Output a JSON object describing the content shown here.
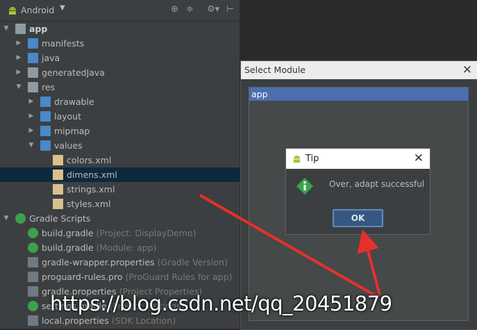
{
  "project_view": {
    "title": "Android",
    "tree": [
      {
        "label": "app",
        "hint": "",
        "depth": 0,
        "arrow": "down",
        "icon": "module-folder-icon",
        "bold": true
      },
      {
        "label": "manifests",
        "hint": "",
        "depth": 1,
        "arrow": "right",
        "icon": "folder-icon"
      },
      {
        "label": "java",
        "hint": "",
        "depth": 1,
        "arrow": "right",
        "icon": "folder-icon"
      },
      {
        "label": "generatedJava",
        "hint": "",
        "depth": 1,
        "arrow": "right",
        "icon": "generated-folder-icon"
      },
      {
        "label": "res",
        "hint": "",
        "depth": 1,
        "arrow": "down",
        "icon": "res-folder-icon"
      },
      {
        "label": "drawable",
        "hint": "",
        "depth": 2,
        "arrow": "right",
        "icon": "folder-icon"
      },
      {
        "label": "layout",
        "hint": "",
        "depth": 2,
        "arrow": "right",
        "icon": "folder-icon"
      },
      {
        "label": "mipmap",
        "hint": "",
        "depth": 2,
        "arrow": "right",
        "icon": "folder-icon"
      },
      {
        "label": "values",
        "hint": "",
        "depth": 2,
        "arrow": "down",
        "icon": "folder-icon"
      },
      {
        "label": "colors.xml",
        "hint": "",
        "depth": 3,
        "arrow": "",
        "icon": "xml-file-icon"
      },
      {
        "label": "dimens.xml",
        "hint": "",
        "depth": 3,
        "arrow": "",
        "icon": "xml-file-icon",
        "selected": true
      },
      {
        "label": "strings.xml",
        "hint": "",
        "depth": 3,
        "arrow": "",
        "icon": "xml-file-icon"
      },
      {
        "label": "styles.xml",
        "hint": "",
        "depth": 3,
        "arrow": "",
        "icon": "xml-file-icon"
      },
      {
        "label": "Gradle Scripts",
        "hint": "",
        "depth": 0,
        "arrow": "down",
        "icon": "gradle-icon"
      },
      {
        "label": "build.gradle",
        "hint": "(Project: DisplayDemo)",
        "depth": 1,
        "arrow": "",
        "icon": "gradle-file-icon"
      },
      {
        "label": "build.gradle",
        "hint": "(Module: app)",
        "depth": 1,
        "arrow": "",
        "icon": "gradle-file-icon"
      },
      {
        "label": "gradle-wrapper.properties",
        "hint": "(Gradle Version)",
        "depth": 1,
        "arrow": "",
        "icon": "properties-file-icon"
      },
      {
        "label": "proguard-rules.pro",
        "hint": "(ProGuard Rules for app)",
        "depth": 1,
        "arrow": "",
        "icon": "pro-file-icon"
      },
      {
        "label": "gradle.properties",
        "hint": "(Project Properties)",
        "depth": 1,
        "arrow": "",
        "icon": "properties-file-icon"
      },
      {
        "label": "settings.gradle",
        "hint": "(Project Settings)",
        "depth": 1,
        "arrow": "",
        "icon": "gradle-file-icon"
      },
      {
        "label": "local.properties",
        "hint": "(SDK Location)",
        "depth": 1,
        "arrow": "",
        "icon": "properties-file-icon"
      }
    ]
  },
  "select_module": {
    "title": "Select Module",
    "items": [
      "app"
    ]
  },
  "tip": {
    "title": "Tip",
    "message": "Over, adapt successful",
    "ok_label": "OK"
  },
  "watermark": "https://blog.csdn.net/qq_20451879",
  "colors": {
    "selection": "#0d293e",
    "list_selection": "#4b6eaf",
    "arrow": "#e8302a"
  }
}
